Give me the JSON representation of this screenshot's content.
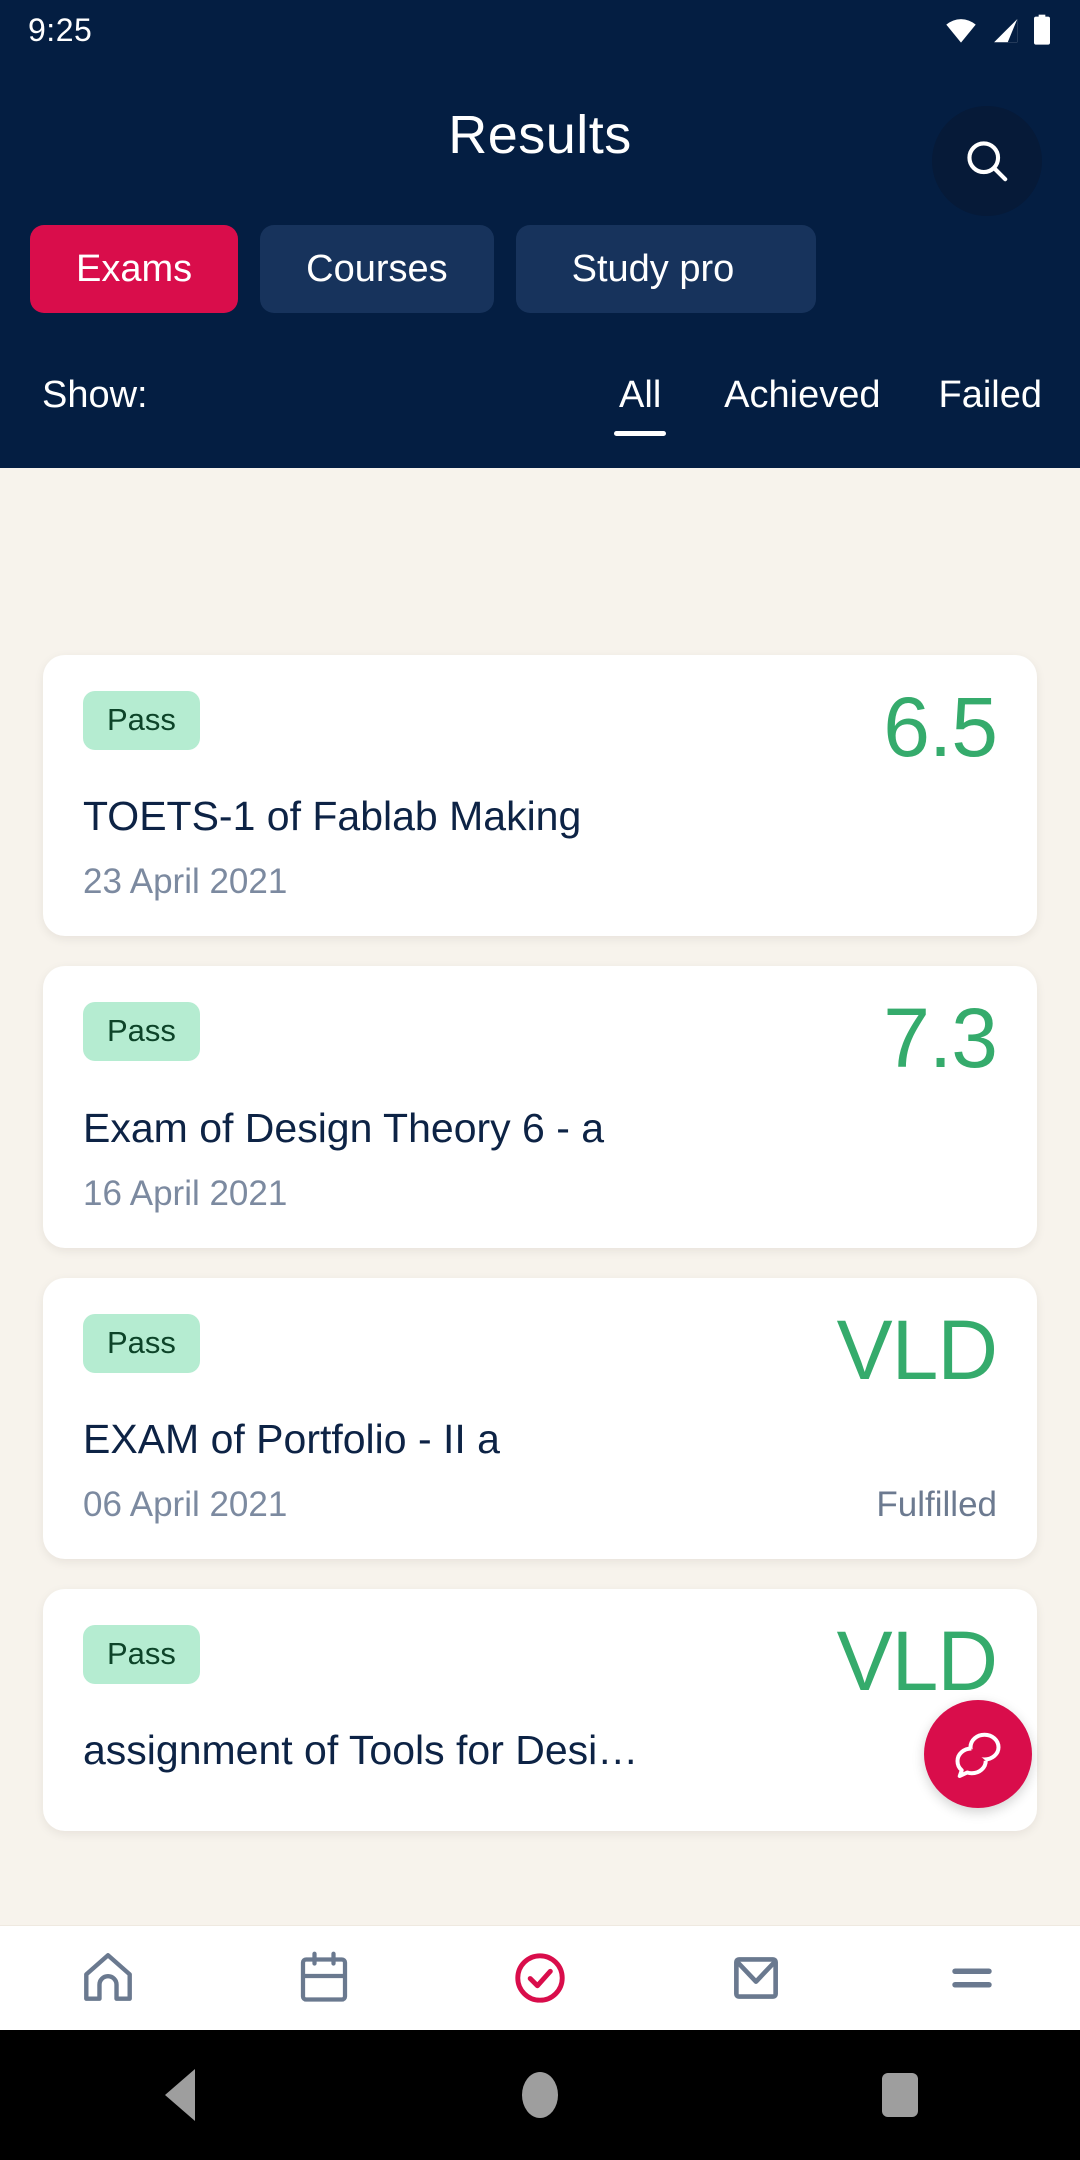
{
  "status_bar": {
    "time": "9:25",
    "icons": [
      "wifi-icon",
      "signal-icon",
      "battery-icon"
    ]
  },
  "header": {
    "title": "Results",
    "search_icon": "search-icon",
    "accent_color": "#d90d4b",
    "background_color": "#041e42"
  },
  "tabs": [
    {
      "label": "Exams",
      "active": true
    },
    {
      "label": "Courses",
      "active": false
    },
    {
      "label": "Study pro",
      "active": false
    }
  ],
  "filter": {
    "label": "Show:",
    "options": [
      {
        "label": "All",
        "active": true
      },
      {
        "label": "Achieved",
        "active": false
      },
      {
        "label": "Failed",
        "active": false
      }
    ]
  },
  "results": [
    {
      "badge": "Pass",
      "grade": "6.5",
      "title": "TOETS-1 of Fablab Making",
      "date": "23 April 2021",
      "status": ""
    },
    {
      "badge": "Pass",
      "grade": "7.3",
      "title": "Exam of Design Theory 6 - a",
      "date": "16 April 2021",
      "status": ""
    },
    {
      "badge": "Pass",
      "grade": "VLD",
      "title": "EXAM of Portfolio - II a",
      "date": "06 April 2021",
      "status": "Fulfilled"
    },
    {
      "badge": "Pass",
      "grade": "VLD",
      "title": "assignment of Tools for Desi…",
      "date": "",
      "status": ""
    }
  ],
  "fab": {
    "icon": "chat-bubbles-icon",
    "color": "#d90d4b"
  },
  "bottom_nav": [
    {
      "icon": "home-icon",
      "active": false
    },
    {
      "icon": "calendar-icon",
      "active": false
    },
    {
      "icon": "check-circle-icon",
      "active": true
    },
    {
      "icon": "mail-icon",
      "active": false
    },
    {
      "icon": "menu-icon",
      "active": false
    }
  ],
  "system_nav": [
    {
      "icon": "back-triangle-icon"
    },
    {
      "icon": "home-circle-icon"
    },
    {
      "icon": "recents-square-icon"
    }
  ],
  "colors": {
    "grade_green": "#35ab6c",
    "badge_bg": "#b5ecd1",
    "badge_text": "#0d4429",
    "page_bg": "#f7f3ec",
    "title_text": "#0d2345",
    "muted_text": "#7c8aa0"
  }
}
